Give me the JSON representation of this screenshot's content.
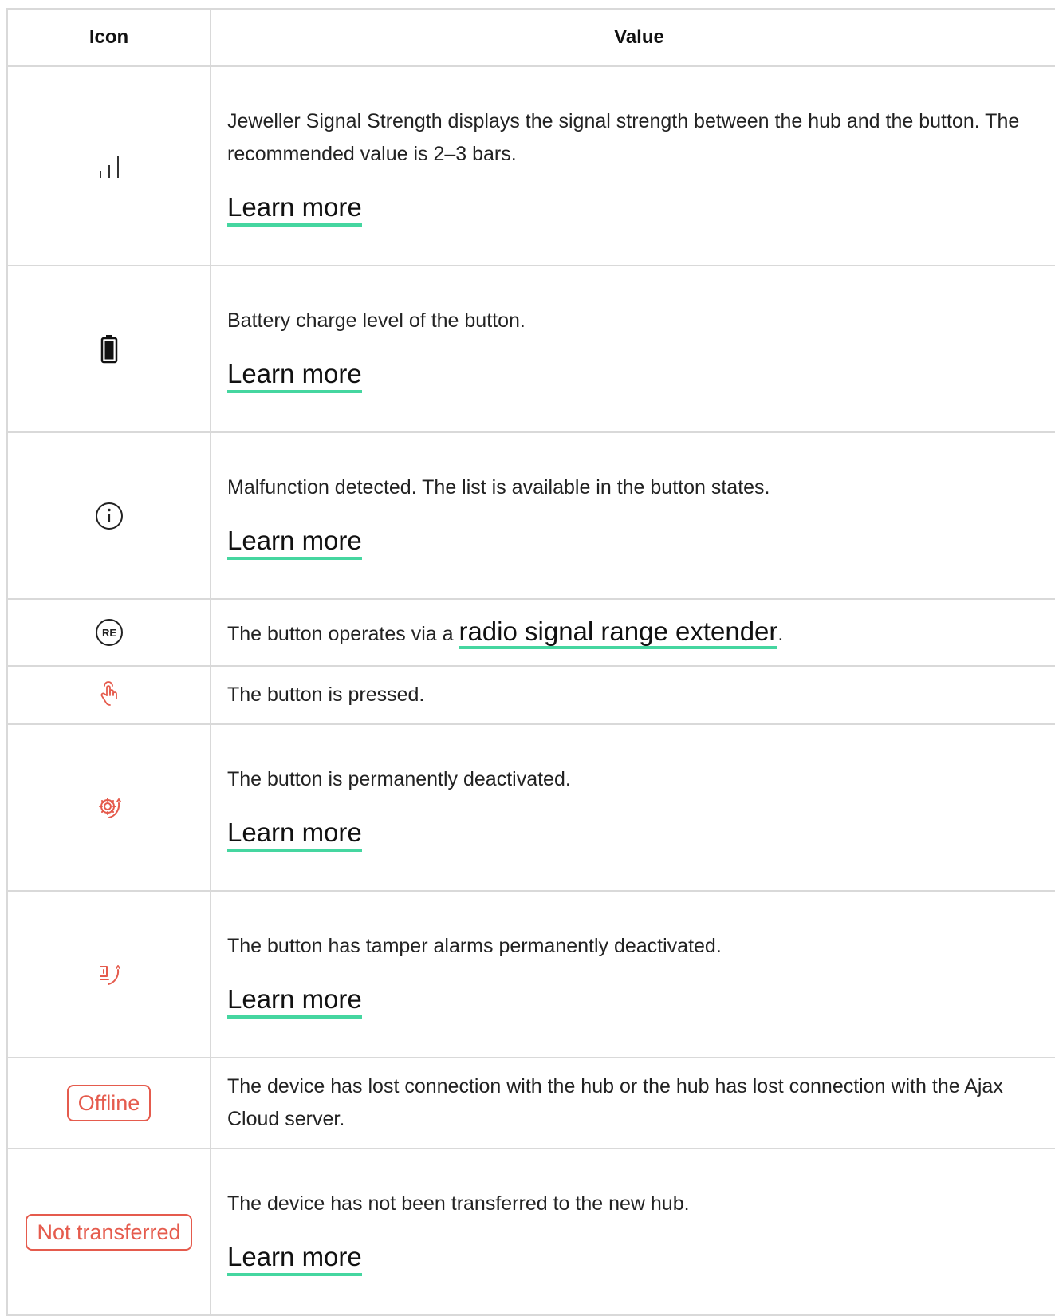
{
  "table": {
    "headers": {
      "icon": "Icon",
      "value": "Value"
    },
    "rows": [
      {
        "icon": "signal-strength-icon",
        "description": "Jeweller Signal Strength displays the signal strength between the hub and the button. The recommended value is 2–3 bars.",
        "link": "Learn more"
      },
      {
        "icon": "battery-icon",
        "description": "Battery charge level of the button.",
        "link": "Learn more"
      },
      {
        "icon": "info-icon",
        "description": "Malfunction detected. The list is available in the button states.",
        "link": "Learn more"
      },
      {
        "icon": "re-icon",
        "icon_text": "RE",
        "description_before": "The button operates via a ",
        "description_link": "radio signal range extender",
        "description_after": "."
      },
      {
        "icon": "hand-press-icon",
        "description": "The button is pressed."
      },
      {
        "icon": "gear-deactivated-icon",
        "description": "The button is permanently deactivated.",
        "link": "Learn more"
      },
      {
        "icon": "tamper-deactivated-icon",
        "description": "The button has tamper alarms permanently deactivated.",
        "link": "Learn more"
      },
      {
        "badge": "Offline",
        "description": "The device has lost connection with the hub or the hub has lost connection with the Ajax Cloud server."
      },
      {
        "badge": "Not transferred",
        "description": "The device has not been transferred to the new hub.",
        "link": "Learn more"
      }
    ]
  },
  "colors": {
    "link_underline": "#45d6a0",
    "alert_red": "#e55b4d",
    "border": "#d9d9d9"
  }
}
